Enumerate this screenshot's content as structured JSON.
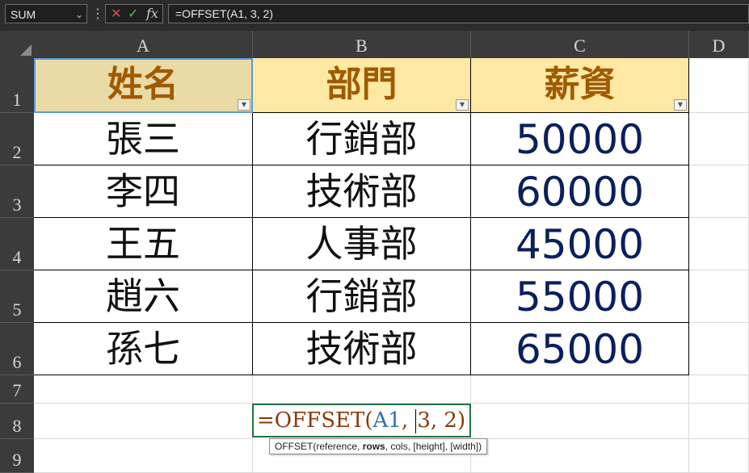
{
  "formula_bar": {
    "name_box": "SUM",
    "cancel_symbol": "✕",
    "enter_symbol": "✓",
    "fx_label": "fx",
    "formula": "=OFFSET(A1, 3, 2)"
  },
  "columns": [
    "A",
    "B",
    "C",
    "D"
  ],
  "rows": [
    "1",
    "2",
    "3",
    "4",
    "5",
    "6",
    "7",
    "8",
    "9"
  ],
  "table": {
    "headers": [
      "姓名",
      "部門",
      "薪資"
    ],
    "rows": [
      [
        "張三",
        "行銷部",
        "50000"
      ],
      [
        "李四",
        "技術部",
        "60000"
      ],
      [
        "王五",
        "人事部",
        "45000"
      ],
      [
        "趙六",
        "行銷部",
        "55000"
      ],
      [
        "孫七",
        "技術部",
        "65000"
      ]
    ]
  },
  "edit_cell": {
    "eq": "=",
    "fn": "OFFSET",
    "open": "(",
    "ref": "A1",
    "args_before_cursor": ", ",
    "args_after_cursor": "3, 2",
    "close": ")"
  },
  "tooltip": {
    "prefix": "OFFSET(reference, ",
    "bold": "rows",
    "suffix": ", cols, [height], [width])"
  },
  "colors": {
    "header_fill": "#fde9a3",
    "header_text": "#a05a00",
    "number_text": "#0b1f5c",
    "active_border": "#217346"
  }
}
